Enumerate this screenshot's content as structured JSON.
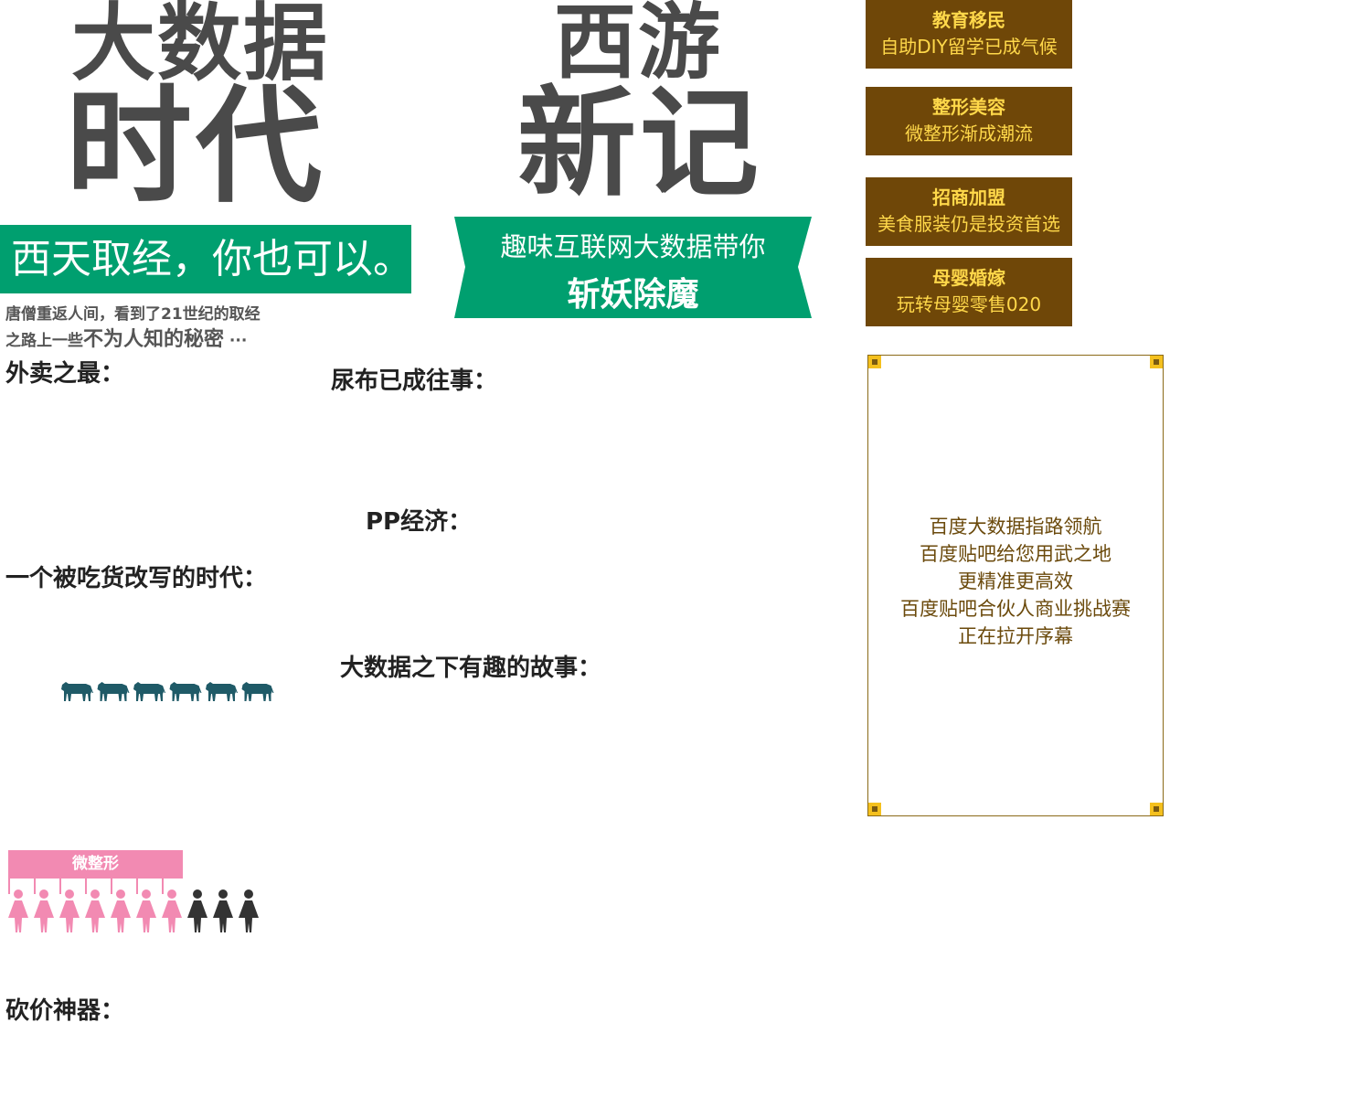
{
  "left_title": {
    "line1": "大数据",
    "line2": "时代"
  },
  "right_title": {
    "line1": "西游",
    "line2": "新记"
  },
  "banner_left": "西天取经，你也可以。",
  "banner_right": {
    "line1": "趣味互联网大数据带你",
    "line2": "斩妖除魔"
  },
  "intro": {
    "line1": "唐僧重返人间，看到了21世纪的取经",
    "line2_prefix": "之路上一些",
    "line2_emphasis": "不为人知的秘密",
    "line2_suffix": " ···"
  },
  "sections": {
    "waimai": "外卖之最：",
    "niaobu": "尿布已成往事：",
    "pp": "PP经济：",
    "chihuo": "一个被吃货改写的时代：",
    "dashuju": "大数据之下有趣的故事：",
    "kanjia": "砍价神器："
  },
  "cards": [
    {
      "title": "教育移民",
      "subtitle": "自助DIY留学已成气候"
    },
    {
      "title": "整形美容",
      "subtitle": "微整形渐成潮流"
    },
    {
      "title": "招商加盟",
      "subtitle": "美食服装仍是投资首选"
    },
    {
      "title": "母婴婚嫁",
      "subtitle": "玩转母婴零售020"
    }
  ],
  "frame_box": {
    "lines": [
      "百度大数据指路领航",
      "百度贴吧给您用武之地",
      "更精准更高效",
      "百度贴吧合伙人商业挑战赛",
      "正在拉开序幕"
    ]
  },
  "infographic": {
    "cow_count": 6,
    "micro_label": "微整形",
    "women_total": 10,
    "women_highlighted": 7
  },
  "colors": {
    "title_gray": "#4a4a4a",
    "banner_green": "#009f6f",
    "card_brown": "#6f4708",
    "card_text_gold": "#ffd84a",
    "frame_text_brown": "#6b4a0c",
    "cow_teal": "#1f5a67",
    "women_pink": "#f28ab2",
    "women_dark": "#333333"
  }
}
